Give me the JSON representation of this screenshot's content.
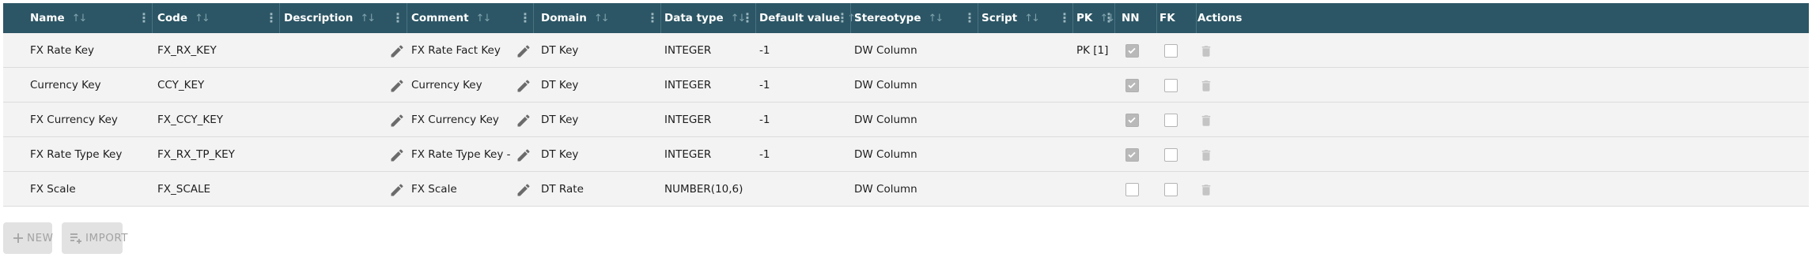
{
  "table": {
    "columns": [
      {
        "label": "Name"
      },
      {
        "label": "Code"
      },
      {
        "label": "Description"
      },
      {
        "label": "Comment"
      },
      {
        "label": "Domain"
      },
      {
        "label": "Data type"
      },
      {
        "label": "Default value"
      },
      {
        "label": "Stereotype"
      },
      {
        "label": "Script"
      },
      {
        "label": "PK"
      },
      {
        "label": "NN"
      },
      {
        "label": "FK"
      },
      {
        "label": "Actions"
      }
    ],
    "rows": [
      {
        "name": "FX Rate Key",
        "code": "FX_RX_KEY",
        "description": "",
        "comment": "FX Rate Fact Key",
        "domain": "DT Key",
        "data_type": "INTEGER",
        "default_value": "-1",
        "stereotype": "DW Column",
        "script": "",
        "pk": "PK [1]",
        "nn": true,
        "fk": false
      },
      {
        "name": "Currency Key",
        "code": "CCY_KEY",
        "description": "",
        "comment": "Currency Key",
        "domain": "DT Key",
        "data_type": "INTEGER",
        "default_value": "-1",
        "stereotype": "DW Column",
        "script": "",
        "pk": "",
        "nn": true,
        "fk": false
      },
      {
        "name": "FX Currency Key",
        "code": "FX_CCY_KEY",
        "description": "",
        "comment": "FX Currency Key",
        "domain": "DT Key",
        "data_type": "INTEGER",
        "default_value": "-1",
        "stereotype": "DW Column",
        "script": "",
        "pk": "",
        "nn": true,
        "fk": false
      },
      {
        "name": "FX Rate Type Key",
        "code": "FX_RX_TP_KEY",
        "description": "",
        "comment": "FX Rate Type Key - Regulatc",
        "domain": "DT Key",
        "data_type": "INTEGER",
        "default_value": "-1",
        "stereotype": "DW Column",
        "script": "",
        "pk": "",
        "nn": true,
        "fk": false
      },
      {
        "name": "FX Scale",
        "code": "FX_SCALE",
        "description": "",
        "comment": "FX Scale",
        "domain": "DT Rate",
        "data_type": "NUMBER(10,6)",
        "default_value": "",
        "stereotype": "DW Column",
        "script": "",
        "pk": "",
        "nn": false,
        "fk": false
      }
    ]
  },
  "toolbar": {
    "new_label": "NEW",
    "import_label": "IMPORT"
  },
  "icons": {
    "sort": "sort-arrows-icon",
    "menu": "kebab-menu-icon",
    "edit": "pencil-icon",
    "delete": "trash-icon",
    "new": "plus-icon",
    "import": "playlist-add-icon"
  },
  "colors": {
    "header_bg": "#2c5665",
    "row_bg": "#f3f3f3",
    "button_bg": "#e2e2e2",
    "icon_grey": "#6b6b6b"
  }
}
